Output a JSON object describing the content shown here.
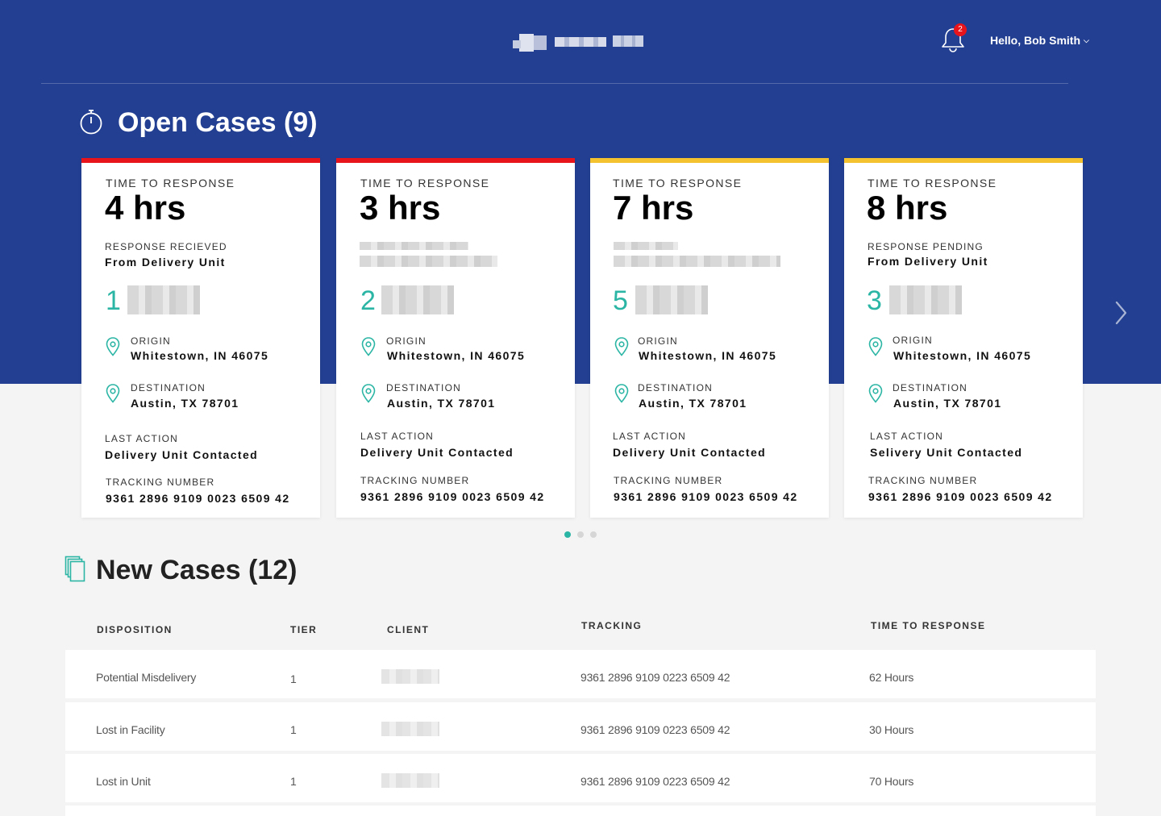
{
  "header": {
    "notification_count": "2",
    "user_greeting": "Hello, Bob Smith"
  },
  "open_cases": {
    "title": "Open Cases (9)",
    "cards": [
      {
        "accent": "#e8141c",
        "time_label": "TIME TO RESPONSE",
        "time_value": "4 hrs",
        "status_label": "RESPONSE RECIEVED",
        "status_value": "From Delivery Unit",
        "count": "1",
        "origin_label": "ORIGIN",
        "origin_value": "Whitestown, IN 46075",
        "destination_label": "DESTINATION",
        "destination_value": "Austin, TX 78701",
        "last_action_label": "LAST ACTION",
        "last_action_value": "Delivery Unit Contacted",
        "tracking_label": "TRACKING NUMBER",
        "tracking_value": "9361 2896 9109 0023 6509 42"
      },
      {
        "accent": "#e8141c",
        "time_label": "TIME TO RESPONSE",
        "time_value": "3 hrs",
        "count": "2",
        "origin_label": "ORIGIN",
        "origin_value": "Whitestown, IN 46075",
        "destination_label": "DESTINATION",
        "destination_value": "Austin, TX 78701",
        "last_action_label": "LAST ACTION",
        "last_action_value": "Delivery Unit Contacted",
        "tracking_label": "TRACKING NUMBER",
        "tracking_value": "9361 2896 9109 0023 6509 42"
      },
      {
        "accent": "#f5c22f",
        "time_label": "TIME TO RESPONSE",
        "time_value": "7 hrs",
        "count": "5",
        "origin_label": "ORIGIN",
        "origin_value": "Whitestown, IN 46075",
        "destination_label": "DESTINATION",
        "destination_value": "Austin, TX 78701",
        "last_action_label": "LAST ACTION",
        "last_action_value": "Delivery Unit Contacted",
        "tracking_label": "TRACKING NUMBER",
        "tracking_value": "9361 2896 9109 0023 6509 42"
      },
      {
        "accent": "#f5c22f",
        "time_label": "TIME TO RESPONSE",
        "time_value": "8 hrs",
        "status_label": "RESPONSE PENDING",
        "status_value": "From Delivery Unit",
        "count": "3",
        "origin_label": "ORIGIN",
        "origin_value": "Whitestown, IN 46075",
        "destination_label": "DESTINATION",
        "destination_value": "Austin, TX 78701",
        "last_action_label": "LAST ACTION",
        "last_action_value": "Selivery Unit Contacted",
        "tracking_label": "TRACKING NUMBER",
        "tracking_value": "9361 2896 9109 0023 6509 42"
      }
    ]
  },
  "new_cases": {
    "title": "New Cases (12)",
    "columns": [
      "DISPOSITION",
      "TIER",
      "CLIENT",
      "TRACKING",
      "TIME TO RESPONSE"
    ],
    "rows": [
      {
        "disposition": "Potential Misdelivery",
        "tier": "1",
        "tracking": "9361 2896 9109 0223 6509 42",
        "time": "62 Hours"
      },
      {
        "disposition": "Lost in Facility",
        "tier": "1",
        "tracking": "9361 2896 9109 0223 6509 42",
        "time": "30 Hours"
      },
      {
        "disposition": "Lost in Unit",
        "tier": "1",
        "tracking": "9361 2896 9109 0223 6509 42",
        "time": "70 Hours"
      }
    ]
  },
  "colors": {
    "brand_blue": "#233f91",
    "teal_accent": "#2bb5a4",
    "urgent_red": "#e8141c",
    "warning_yellow": "#f5c22f"
  },
  "icons": [
    "bell-icon",
    "stopwatch-icon",
    "map-pin-icon",
    "chevron-right-icon",
    "copy-icon"
  ]
}
